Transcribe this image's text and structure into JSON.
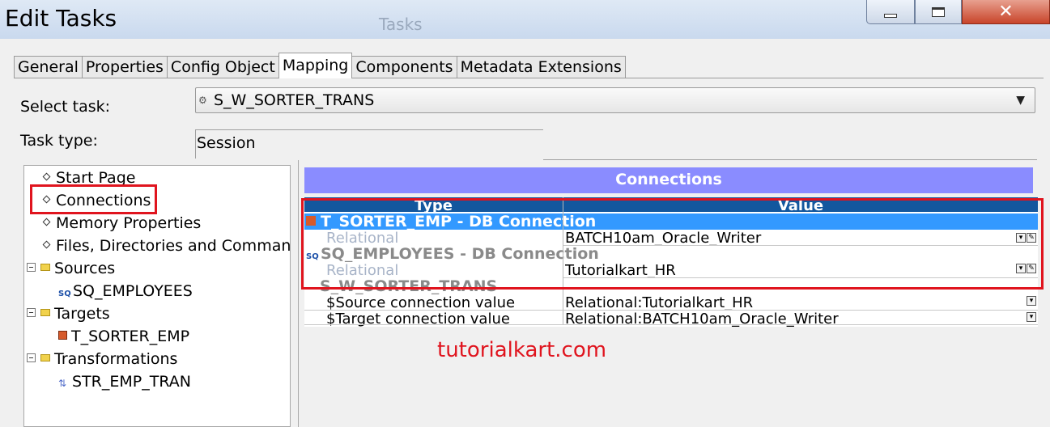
{
  "window": {
    "title": "Edit Tasks",
    "background_labels": [
      "Tasks"
    ],
    "controls": {
      "minimize": "—",
      "maximize": "□",
      "close": "✕"
    }
  },
  "tabs": [
    {
      "label": "General",
      "active": false
    },
    {
      "label": "Properties",
      "active": false
    },
    {
      "label": "Config Object",
      "active": false
    },
    {
      "label": "Mapping",
      "active": true
    },
    {
      "label": "Components",
      "active": false
    },
    {
      "label": "Metadata Extensions",
      "active": false
    }
  ],
  "form": {
    "select_task_label": "Select task:",
    "select_task_value": "S_W_SORTER_TRANS",
    "task_type_label": "Task type:",
    "task_type_value": "Session"
  },
  "tree": {
    "start_page": "Start Page",
    "connections": "Connections",
    "memory_properties": "Memory Properties",
    "files_dirs": "Files, Directories and Commands",
    "sources": "Sources",
    "sq_employees": "SQ_EMPLOYEES",
    "targets": "Targets",
    "t_sorter_emp": "T_SORTER_EMP",
    "transformations": "Transformations",
    "str_emp_tran": "STR_EMP_TRAN"
  },
  "connections": {
    "header": "Connections",
    "col_type": "Type",
    "col_value": "Value",
    "group1_title": "T_SORTER_EMP - DB Connection",
    "group1_type": "Relational",
    "group1_value": "BATCH10am_Oracle_Writer",
    "group2_title": "SQ_EMPLOYEES - DB Connection",
    "group2_type": "Relational",
    "group2_value": "Tutorialkart_HR",
    "group3_title": "S_W_SORTER_TRANS",
    "row3_name": "$Source connection value",
    "row3_value": "Relational:Tutorialkart_HR",
    "row4_name": "$Target connection value",
    "row4_value": "Relational:BATCH10am_Oracle_Writer"
  },
  "watermark": "tutorialkart.com",
  "colors": {
    "selected_row": "#3399ff",
    "header_band": "#8a8cff",
    "column_header": "#13579e",
    "highlight": "#e0141e"
  }
}
